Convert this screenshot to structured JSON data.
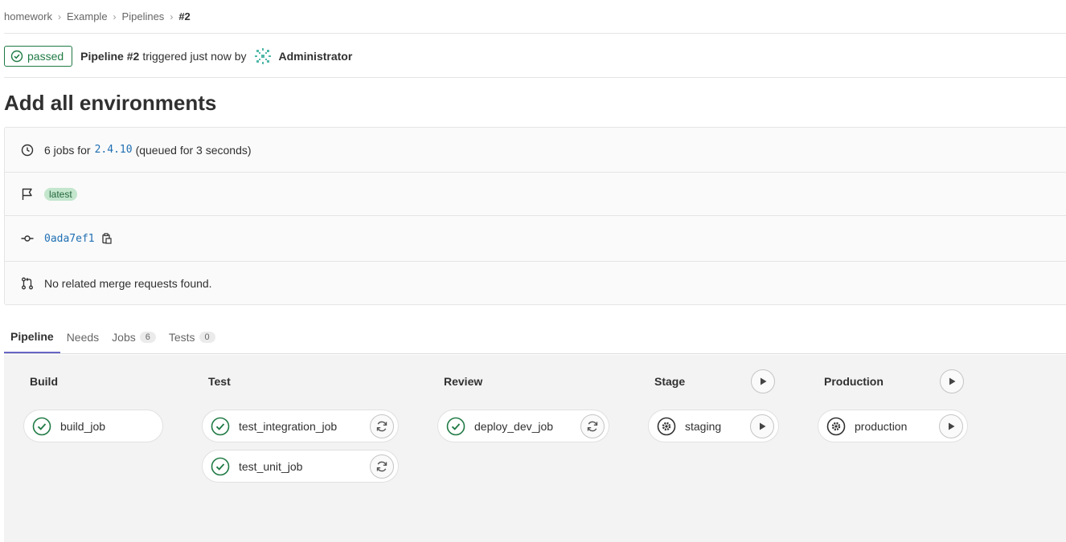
{
  "breadcrumb": [
    "homework",
    "Example",
    "Pipelines",
    "#2"
  ],
  "header": {
    "status": "passed",
    "pipeline_label": "Pipeline #2",
    "triggered_text": "triggered just now by",
    "user": "Administrator"
  },
  "title": "Add all environments",
  "info": {
    "jobs_prefix": "6 jobs for",
    "ref": "2.4.10",
    "queued": "(queued for 3 seconds)",
    "tag": "latest",
    "commit": "0ada7ef1",
    "merge_requests": "No related merge requests found."
  },
  "tabs": [
    {
      "label": "Pipeline",
      "count": null,
      "active": true
    },
    {
      "label": "Needs",
      "count": null
    },
    {
      "label": "Jobs",
      "count": "6"
    },
    {
      "label": "Tests",
      "count": "0"
    }
  ],
  "stages": [
    {
      "name": "Build",
      "jobs": [
        {
          "name": "build_job",
          "status": "success",
          "action": null
        }
      ]
    },
    {
      "name": "Test",
      "jobs": [
        {
          "name": "test_integration_job",
          "status": "success",
          "action": "retry-icon"
        },
        {
          "name": "test_unit_job",
          "status": "success",
          "action": "retry-icon"
        }
      ]
    },
    {
      "name": "Review",
      "jobs": [
        {
          "name": "deploy_dev_job",
          "status": "success",
          "action": "retry-icon"
        }
      ]
    },
    {
      "name": "Stage",
      "stage_action": "play-icon",
      "jobs": [
        {
          "name": "staging",
          "status": "manual",
          "action": "play-icon"
        }
      ]
    },
    {
      "name": "Production",
      "stage_action": "play-icon",
      "jobs": [
        {
          "name": "production",
          "status": "manual",
          "action": "play-icon"
        }
      ]
    }
  ],
  "colors": {
    "success": "#1f7a44",
    "link": "#1f6fb3",
    "tab_active": "#6666c4"
  }
}
